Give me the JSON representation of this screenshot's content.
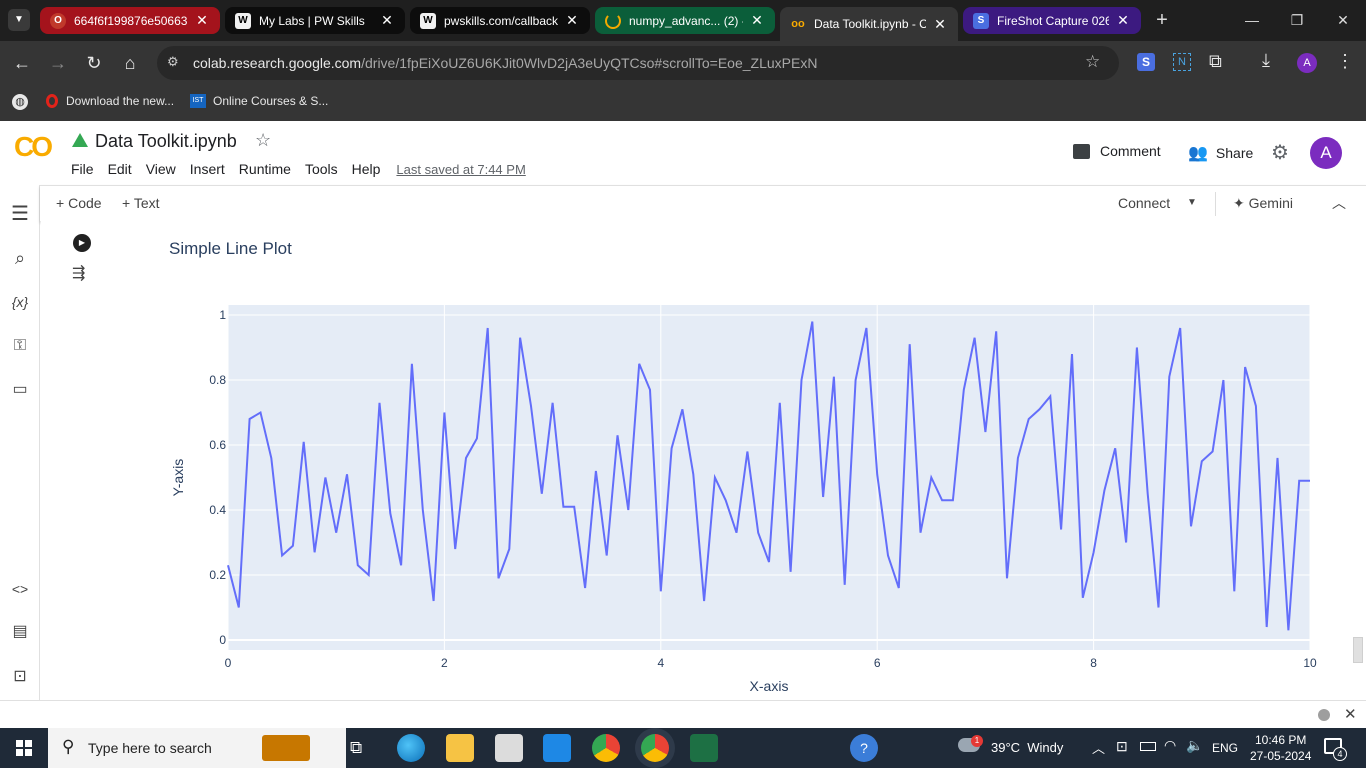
{
  "browser": {
    "tabs": [
      {
        "title": "664f6f199876e50663",
        "color": "#8b0000",
        "accent": "#c0392b",
        "icon": "opera-icon"
      },
      {
        "title": "My Labs | PW Skills",
        "color": "#000000",
        "accent": "#f1f1f1",
        "icon": "pw-skills-icon"
      },
      {
        "title": "pwskills.com/callback",
        "color": "#000000",
        "accent": "#f1f1f1",
        "icon": "pw-skills-icon"
      },
      {
        "title": "numpy_advanc... (2) -",
        "color": "#0b5e3a",
        "accent": "#f2a900",
        "icon": "colab-loading-icon"
      },
      {
        "title": "Data Toolkit.ipynb - C",
        "color": "#353535",
        "accent": "#f9ab00",
        "icon": "colab-icon"
      },
      {
        "title": "FireShot Capture 026",
        "color": "#3c1a80",
        "accent": "#4a6ee0",
        "icon": "fireshot-icon"
      }
    ],
    "url_host": "colab.research.google.com",
    "url_path": "/drive/1fpEiXoUZ6U6KJit0WlvD2jA3eUyQTCso#scrollTo=Eoe_ZLuxPExN",
    "bookmarks": [
      {
        "label": "Download the new...",
        "icon": "opera-icon"
      },
      {
        "label": "Online Courses & S...",
        "icon": "ist-icon"
      }
    ],
    "profile_initial": "A",
    "account_color": "#7b2cbf"
  },
  "colab": {
    "logo_text": "CO",
    "notebook_title": "Data Toolkit.ipynb",
    "menu": [
      "File",
      "Edit",
      "View",
      "Insert",
      "Runtime",
      "Tools",
      "Help"
    ],
    "last_saved": "Last saved at 7:44 PM",
    "comment_label": "Comment",
    "share_label": "Share",
    "avatar_initial": "A",
    "add_code_label": "Code",
    "add_text_label": "Text",
    "connect_label": "Connect",
    "gemini_label": "Gemini",
    "cell_output_title": "Simple Line Plot"
  },
  "chart_data": {
    "type": "line",
    "title": "Simple Line Plot",
    "xlabel": "X-axis",
    "ylabel": "Y-axis",
    "xlim": [
      0,
      10
    ],
    "ylim": [
      0,
      1
    ],
    "x_ticks": [
      "0",
      "2",
      "4",
      "6",
      "8",
      "10"
    ],
    "y_ticks": [
      "0",
      "0.2",
      "0.4",
      "0.6",
      "0.8",
      "1"
    ],
    "grid": true,
    "color": "#636efa",
    "background": "#e5ecf6",
    "series": [
      {
        "x": [
          0,
          0.1,
          0.2,
          0.3,
          0.4,
          0.5,
          0.6,
          0.7,
          0.8,
          0.9,
          1.0,
          1.1,
          1.2,
          1.3,
          1.4,
          1.5,
          1.6,
          1.7,
          1.8,
          1.9,
          2.0,
          2.1,
          2.2,
          2.3,
          2.4,
          2.5,
          2.6,
          2.7,
          2.8,
          2.9,
          3.0,
          3.1,
          3.2,
          3.3,
          3.4,
          3.5,
          3.6,
          3.7,
          3.8,
          3.9,
          4.0,
          4.1,
          4.2,
          4.3,
          4.4,
          4.5,
          4.6,
          4.7,
          4.8,
          4.9,
          5.0,
          5.1,
          5.2,
          5.3,
          5.4,
          5.5,
          5.6,
          5.7,
          5.8,
          5.9,
          6.0,
          6.1,
          6.2,
          6.3,
          6.4,
          6.5,
          6.6,
          6.7,
          6.8,
          6.9,
          7.0,
          7.1,
          7.2,
          7.3,
          7.4,
          7.5,
          7.6,
          7.7,
          7.8,
          7.9,
          8.0,
          8.1,
          8.2,
          8.3,
          8.4,
          8.5,
          8.6,
          8.7,
          8.8,
          8.9,
          9.0,
          9.1,
          9.2,
          9.3,
          9.4,
          9.5,
          9.6,
          9.7,
          9.8,
          9.9,
          10.0
        ],
        "y": [
          0.23,
          0.1,
          0.68,
          0.7,
          0.56,
          0.26,
          0.29,
          0.61,
          0.27,
          0.5,
          0.33,
          0.51,
          0.23,
          0.2,
          0.73,
          0.39,
          0.23,
          0.85,
          0.4,
          0.12,
          0.7,
          0.28,
          0.56,
          0.62,
          0.96,
          0.19,
          0.28,
          0.93,
          0.72,
          0.45,
          0.73,
          0.41,
          0.41,
          0.16,
          0.52,
          0.26,
          0.63,
          0.4,
          0.85,
          0.77,
          0.15,
          0.59,
          0.71,
          0.51,
          0.12,
          0.5,
          0.43,
          0.33,
          0.58,
          0.33,
          0.24,
          0.73,
          0.21,
          0.8,
          0.98,
          0.44,
          0.81,
          0.17,
          0.8,
          0.96,
          0.51,
          0.26,
          0.16,
          0.91,
          0.33,
          0.5,
          0.43,
          0.43,
          0.77,
          0.93,
          0.64,
          0.95,
          0.19,
          0.56,
          0.68,
          0.71,
          0.75,
          0.34,
          0.88,
          0.13,
          0.27,
          0.46,
          0.59,
          0.3,
          0.9,
          0.45,
          0.1,
          0.81,
          0.96,
          0.35,
          0.55,
          0.58,
          0.8,
          0.15,
          0.84,
          0.72,
          0.04,
          0.56,
          0.03,
          0.49,
          0.49
        ]
      }
    ]
  },
  "taskbar": {
    "search_placeholder": "Type here to search",
    "weather": "39°C  Windy",
    "lang": "ENG",
    "time": "10:46 PM",
    "date": "27-05-2024",
    "notification_count": "4",
    "weather_badge": "1"
  }
}
